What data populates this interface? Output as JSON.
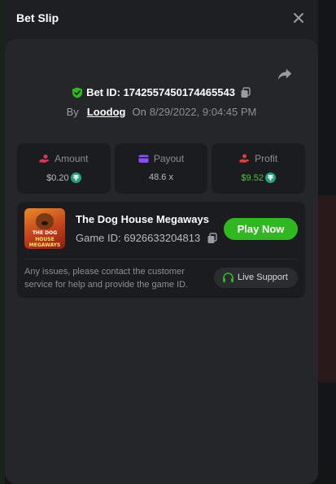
{
  "modal": {
    "title": "Bet Slip"
  },
  "bet": {
    "id_text": "Bet ID: 1742557450174465543",
    "by_label": "By",
    "username": "Loodog",
    "on_label": "On",
    "datetime": "8/29/2022, 9:04:45 PM"
  },
  "stats": {
    "amount_label": "Amount",
    "amount_value": "$0.20",
    "payout_label": "Payout",
    "payout_value": "48.6 x",
    "profit_label": "Profit",
    "profit_value": "$9.52"
  },
  "game": {
    "name": "The Dog House Megaways",
    "id_text": "Game ID: 6926633204813",
    "thumb_line1": "THE DOG",
    "thumb_line2": "HOUSE",
    "thumb_line3": "MEGAWAYS",
    "play_label": "Play Now"
  },
  "support": {
    "help_text": "Any issues, please contact the customer service for help and provide the game ID.",
    "live_label": "Live Support"
  },
  "icons": {
    "close": "close-icon",
    "share": "share-icon",
    "verified": "shield-check-icon",
    "copy": "copy-icon",
    "amount": "hand-coin-icon",
    "payout": "wallet-icon",
    "profit": "hand-coin-icon",
    "coin": "tether-coin-icon",
    "support": "headset-icon"
  },
  "colors": {
    "accent_green": "#2fb81f",
    "profit_green": "#4ec33a",
    "amount_pink": "#e0325f",
    "payout_purple": "#8a4dff",
    "profit_red": "#e23b3b",
    "tether": "#26a17b"
  }
}
